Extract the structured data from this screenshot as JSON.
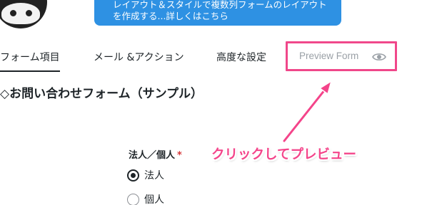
{
  "banner": {
    "line1": "レイアウト＆スタイルで複数列フォームのレイアウト",
    "line2": "を作成する...詳しくはこちら"
  },
  "tabs": [
    {
      "label": "フォーム項目",
      "active": true
    },
    {
      "label": "メール &アクション",
      "active": false
    },
    {
      "label": "高度な設定",
      "active": false
    }
  ],
  "preview": {
    "label": "Preview Form",
    "icon": "eye-icon"
  },
  "form": {
    "title": "◇お問い合わせフォーム（サンプル）",
    "field": {
      "label": "法人／個人",
      "required_mark": "*",
      "options": [
        {
          "label": "法人",
          "checked": true
        },
        {
          "label": "個人",
          "checked": false
        }
      ]
    }
  },
  "annotation": {
    "text": "クリックしてプレビュー",
    "color": "#f4448a"
  },
  "colors": {
    "accent": "#f0478a",
    "banner": "#2e91e3",
    "required": "#d63638"
  }
}
